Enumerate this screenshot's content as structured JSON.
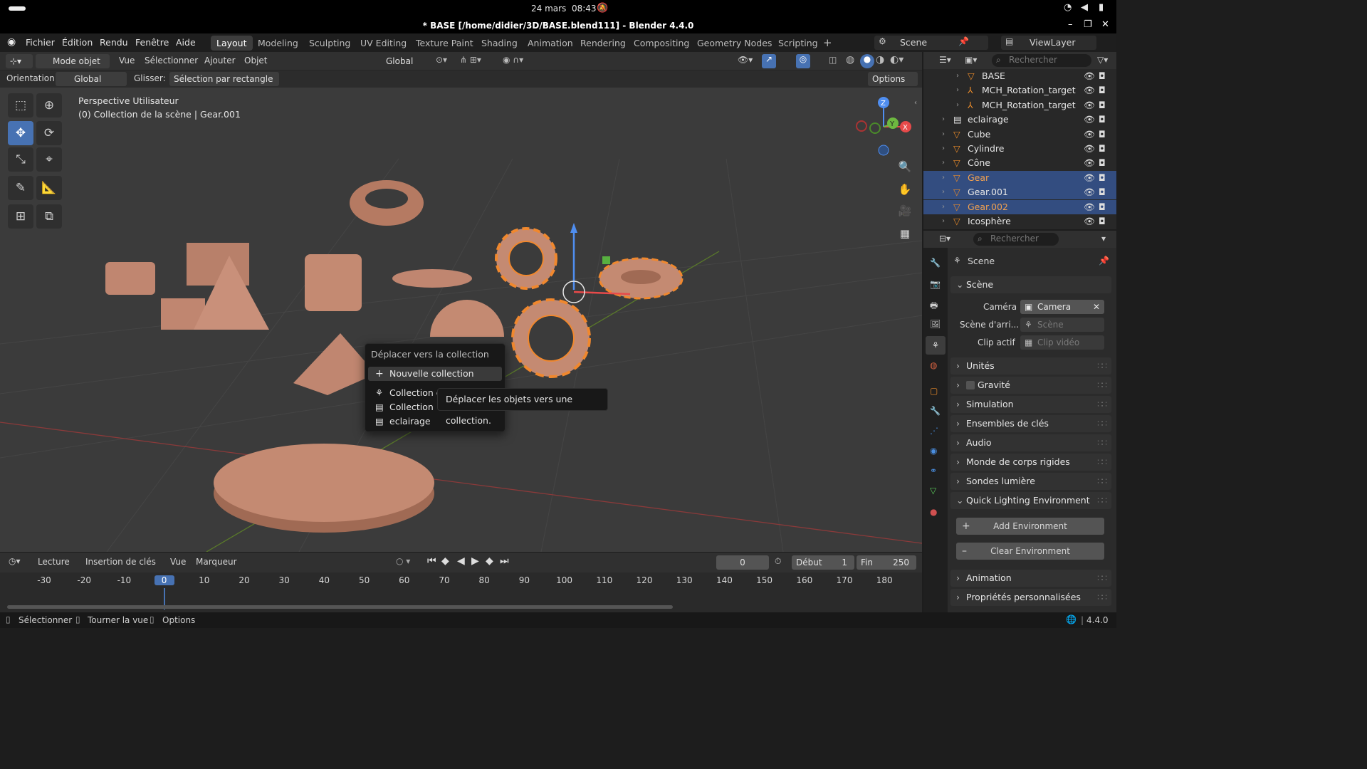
{
  "system": {
    "date": "24 mars",
    "time": "08:43"
  },
  "window": {
    "title": "* BASE [/home/didier/3D/BASE.blend111] - Blender 4.4.0"
  },
  "menu": [
    "Fichier",
    "Édition",
    "Rendu",
    "Fenêtre",
    "Aide"
  ],
  "workspaces": [
    "Layout",
    "Modeling",
    "Sculpting",
    "UV Editing",
    "Texture Paint",
    "Shading",
    "Animation",
    "Rendering",
    "Compositing",
    "Geometry Nodes",
    "Scripting"
  ],
  "scene_name": "Scene",
  "view_layer": "ViewLayer",
  "viewport": {
    "mode": "Mode objet",
    "menus": [
      "Vue",
      "Sélectionner",
      "Ajouter",
      "Objet"
    ],
    "transform": "Global",
    "orientation_label": "Orientation:",
    "orientation_value": "Global",
    "drag_label": "Glisser:",
    "drag_value": "Sélection par rectangle",
    "options": "Options",
    "info_line1": "Perspective Utilisateur",
    "info_line2": "(0) Collection de la scène | Gear.001",
    "axis_x": "X",
    "axis_y": "Y",
    "axis_z": "Z"
  },
  "popup": {
    "title": "Déplacer vers la collection",
    "items": [
      "Nouvelle collection",
      "Collection d",
      "Collection",
      "eclairage"
    ],
    "tooltip": "Déplacer les objets vers une collection."
  },
  "timeline": {
    "menus": [
      "Lecture",
      "Insertion de clés",
      "Vue",
      "Marqueur"
    ],
    "current_frame": "0",
    "start_label": "Début",
    "start": "1",
    "end_label": "Fin",
    "end": "250",
    "ticks": [
      "-30",
      "-20",
      "-10",
      "0",
      "10",
      "20",
      "30",
      "40",
      "50",
      "60",
      "70",
      "80",
      "90",
      "100",
      "110",
      "120",
      "130",
      "140",
      "150",
      "160",
      "170",
      "180"
    ]
  },
  "outliner": {
    "search_placeholder": "Rechercher",
    "rows": [
      {
        "name": "BASE",
        "sel": false,
        "indent": 2
      },
      {
        "name": "MCH_Rotation_target",
        "sel": false,
        "indent": 2
      },
      {
        "name": "MCH_Rotation_target",
        "sel": false,
        "indent": 2
      },
      {
        "name": "eclairage",
        "sel": false,
        "indent": 1
      },
      {
        "name": "Cube",
        "sel": false,
        "indent": 1
      },
      {
        "name": "Cylindre",
        "sel": false,
        "indent": 1
      },
      {
        "name": "Cône",
        "sel": false,
        "indent": 1
      },
      {
        "name": "Gear",
        "sel": true,
        "indent": 1
      },
      {
        "name": "Gear.001",
        "sel": true,
        "indent": 1
      },
      {
        "name": "Gear.002",
        "sel": true,
        "indent": 1
      },
      {
        "name": "Icosphère",
        "sel": false,
        "indent": 1
      }
    ]
  },
  "properties": {
    "search_placeholder": "Rechercher",
    "header": "Scene",
    "section": "Scène",
    "camera_label": "Caméra",
    "camera_value": "Camera",
    "bg_label": "Scène d'arri...",
    "bg_placeholder": "Scène",
    "clip_label": "Clip actif",
    "clip_placeholder": "Clip vidéo",
    "panels": [
      "Unités",
      "Gravité",
      "Simulation",
      "Ensembles de clés",
      "Audio",
      "Monde de corps rigides",
      "Sondes lumière",
      "Quick Lighting Environment"
    ],
    "add_env": "Add Environment",
    "clear_env": "Clear Environment",
    "panels_after": [
      "Animation",
      "Propriétés personnalisées"
    ]
  },
  "status": {
    "select": "Sélectionner",
    "rotate": "Tourner la vue",
    "options": "Options",
    "version": "4.4.0"
  },
  "colors": {
    "accent": "#4772b3",
    "object": "#c4896f",
    "selected_outline": "#f0882e",
    "selection_row": "#334d80"
  }
}
